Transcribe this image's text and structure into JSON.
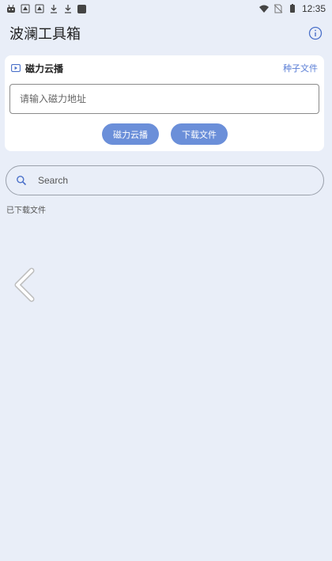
{
  "status_bar": {
    "time": "12:35",
    "icons_left": [
      "robot-icon",
      "app-icon",
      "app-icon",
      "download-icon",
      "download-icon",
      "square-icon"
    ],
    "icons_right": [
      "wifi-icon",
      "no-sim-icon",
      "battery-icon"
    ]
  },
  "header": {
    "title": "波澜工具箱",
    "info_icon": "info-icon"
  },
  "magnet_card": {
    "title": "磁力云播",
    "title_icon": "play-icon",
    "seed_link": "种子文件",
    "input_placeholder": "请输入磁力地址",
    "input_value": "",
    "cloud_play_button": "磁力云播",
    "download_button": "下载文件"
  },
  "search": {
    "placeholder": "Search",
    "value": ""
  },
  "downloaded_label": "已下载文件",
  "colors": {
    "background": "#e9eef8",
    "accent": "#6b8fd9",
    "link": "#5a7ed6"
  }
}
